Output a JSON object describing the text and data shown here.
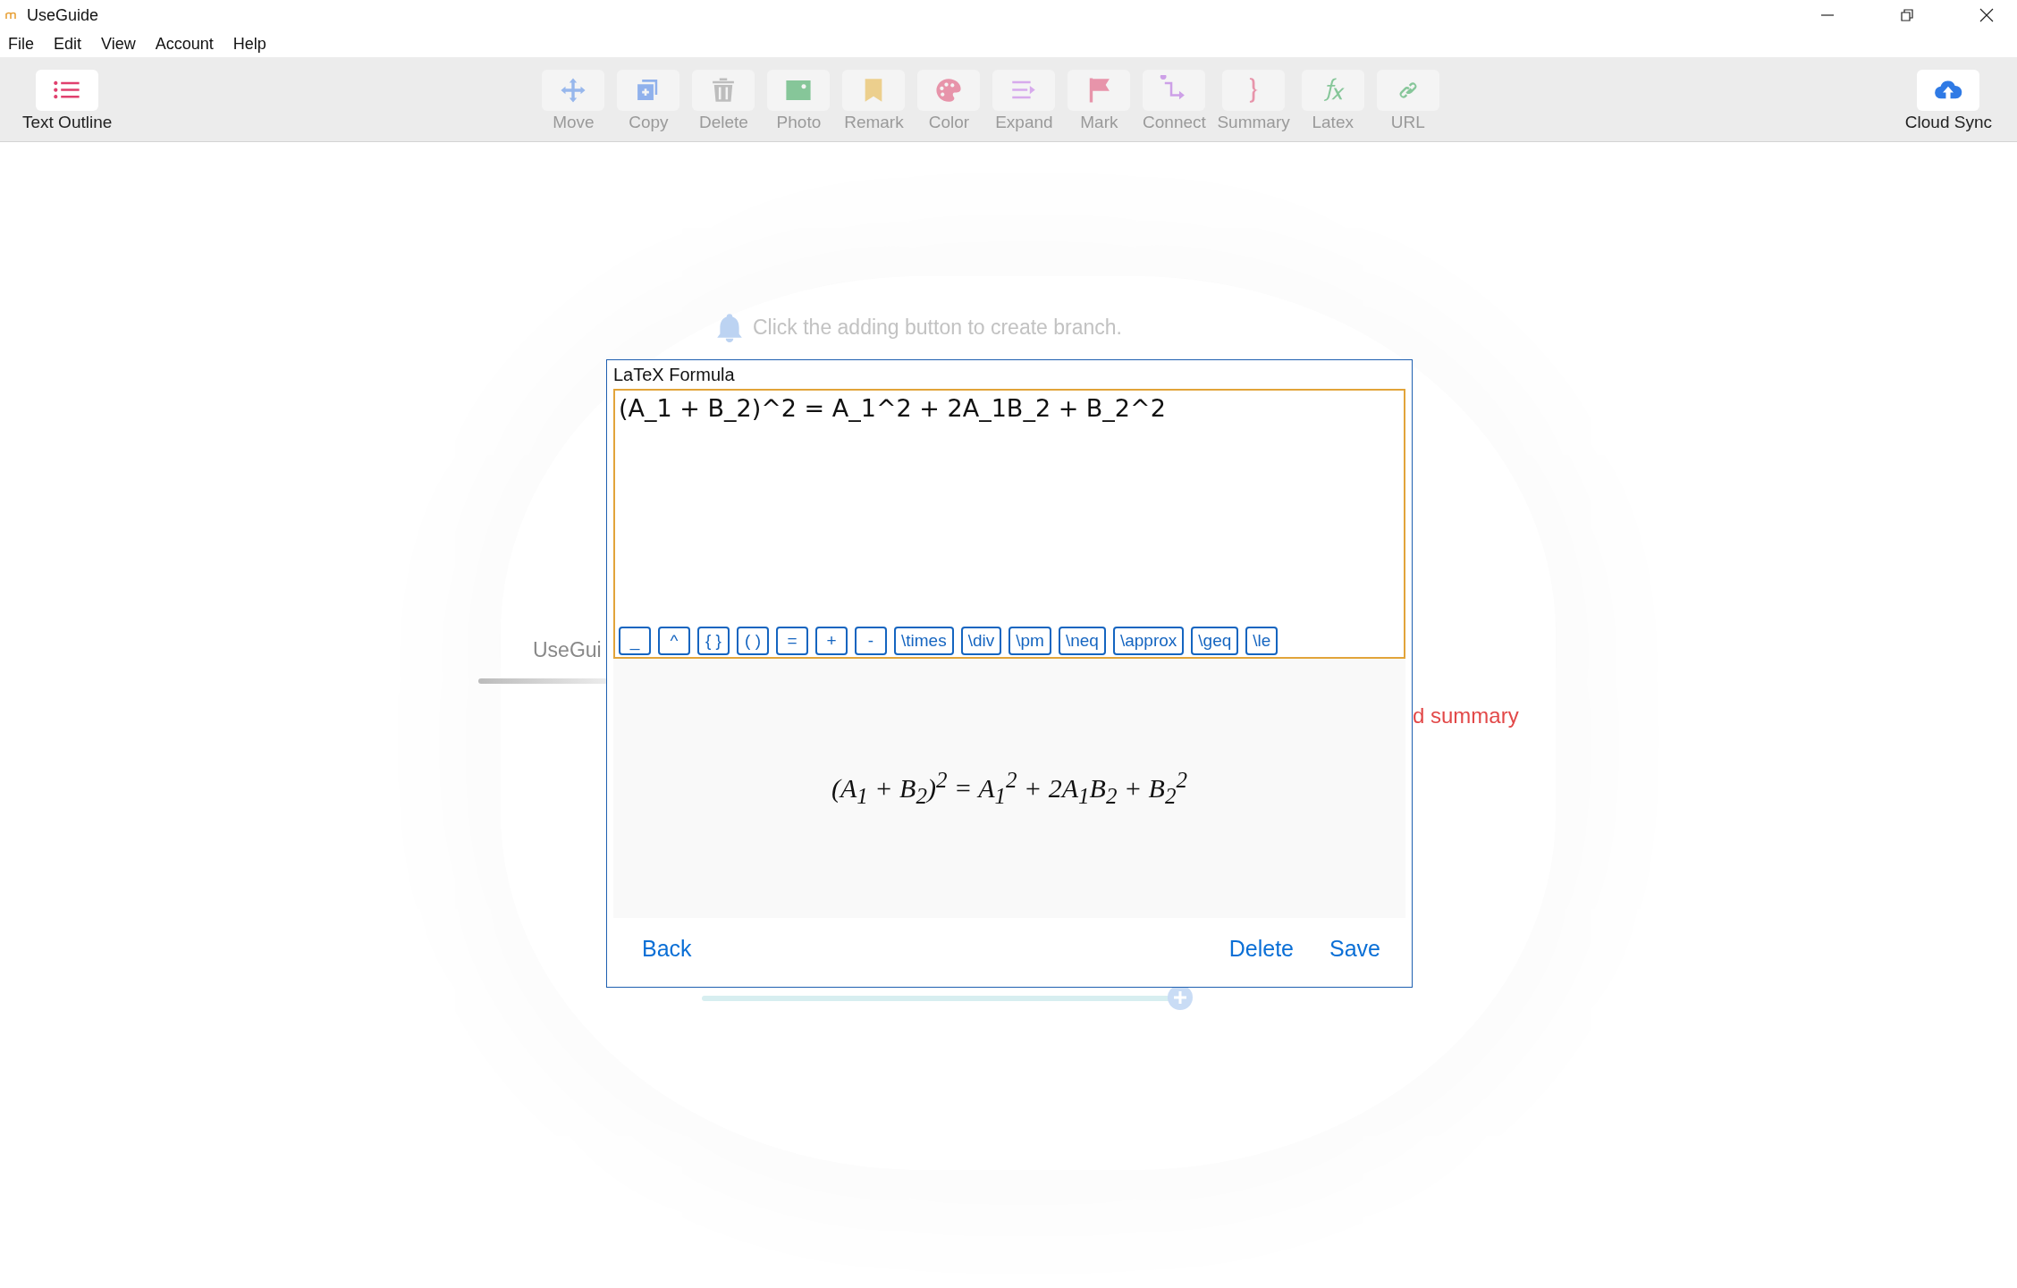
{
  "window": {
    "title": "UseGuide"
  },
  "menu": [
    "File",
    "Edit",
    "View",
    "Account",
    "Help"
  ],
  "toolbar": {
    "left": {
      "label": "Text Outline",
      "disabled": false
    },
    "tools": [
      {
        "label": "Move",
        "disabled": true
      },
      {
        "label": "Copy",
        "disabled": true
      },
      {
        "label": "Delete",
        "disabled": true
      },
      {
        "label": "Photo",
        "disabled": true
      },
      {
        "label": "Remark",
        "disabled": true
      },
      {
        "label": "Color",
        "disabled": true
      },
      {
        "label": "Expand",
        "disabled": true
      },
      {
        "label": "Mark",
        "disabled": true
      },
      {
        "label": "Connect",
        "disabled": true
      },
      {
        "label": "Summary",
        "disabled": true
      },
      {
        "label": "Latex",
        "disabled": true
      },
      {
        "label": "URL",
        "disabled": true
      }
    ],
    "right": {
      "label": "Cloud Sync",
      "disabled": false
    }
  },
  "canvas": {
    "hint": "Click the adding button to create branch.",
    "root_label": "UseGui",
    "summary_label": "d summary"
  },
  "dialog": {
    "title": "LaTeX Formula",
    "value": "(A_1 + B_2)^2 = A_1^2 + 2A_1B_2 + B_2^2",
    "snippets": [
      "_",
      "^",
      "{ }",
      "( )",
      "=",
      "+",
      "-",
      "\\times",
      "\\div",
      "\\pm",
      "\\neq",
      "\\approx",
      "\\geq",
      "\\le"
    ],
    "preview": "(A$_{1}$ + B$_{2}$)$^{2}$ = A$_{1}$$^{2}$ + 2A$_{1}$B$_{2}$ + B$_{2}$$^{2}$",
    "buttons": {
      "back": "Back",
      "delete": "Delete",
      "save": "Save"
    }
  }
}
